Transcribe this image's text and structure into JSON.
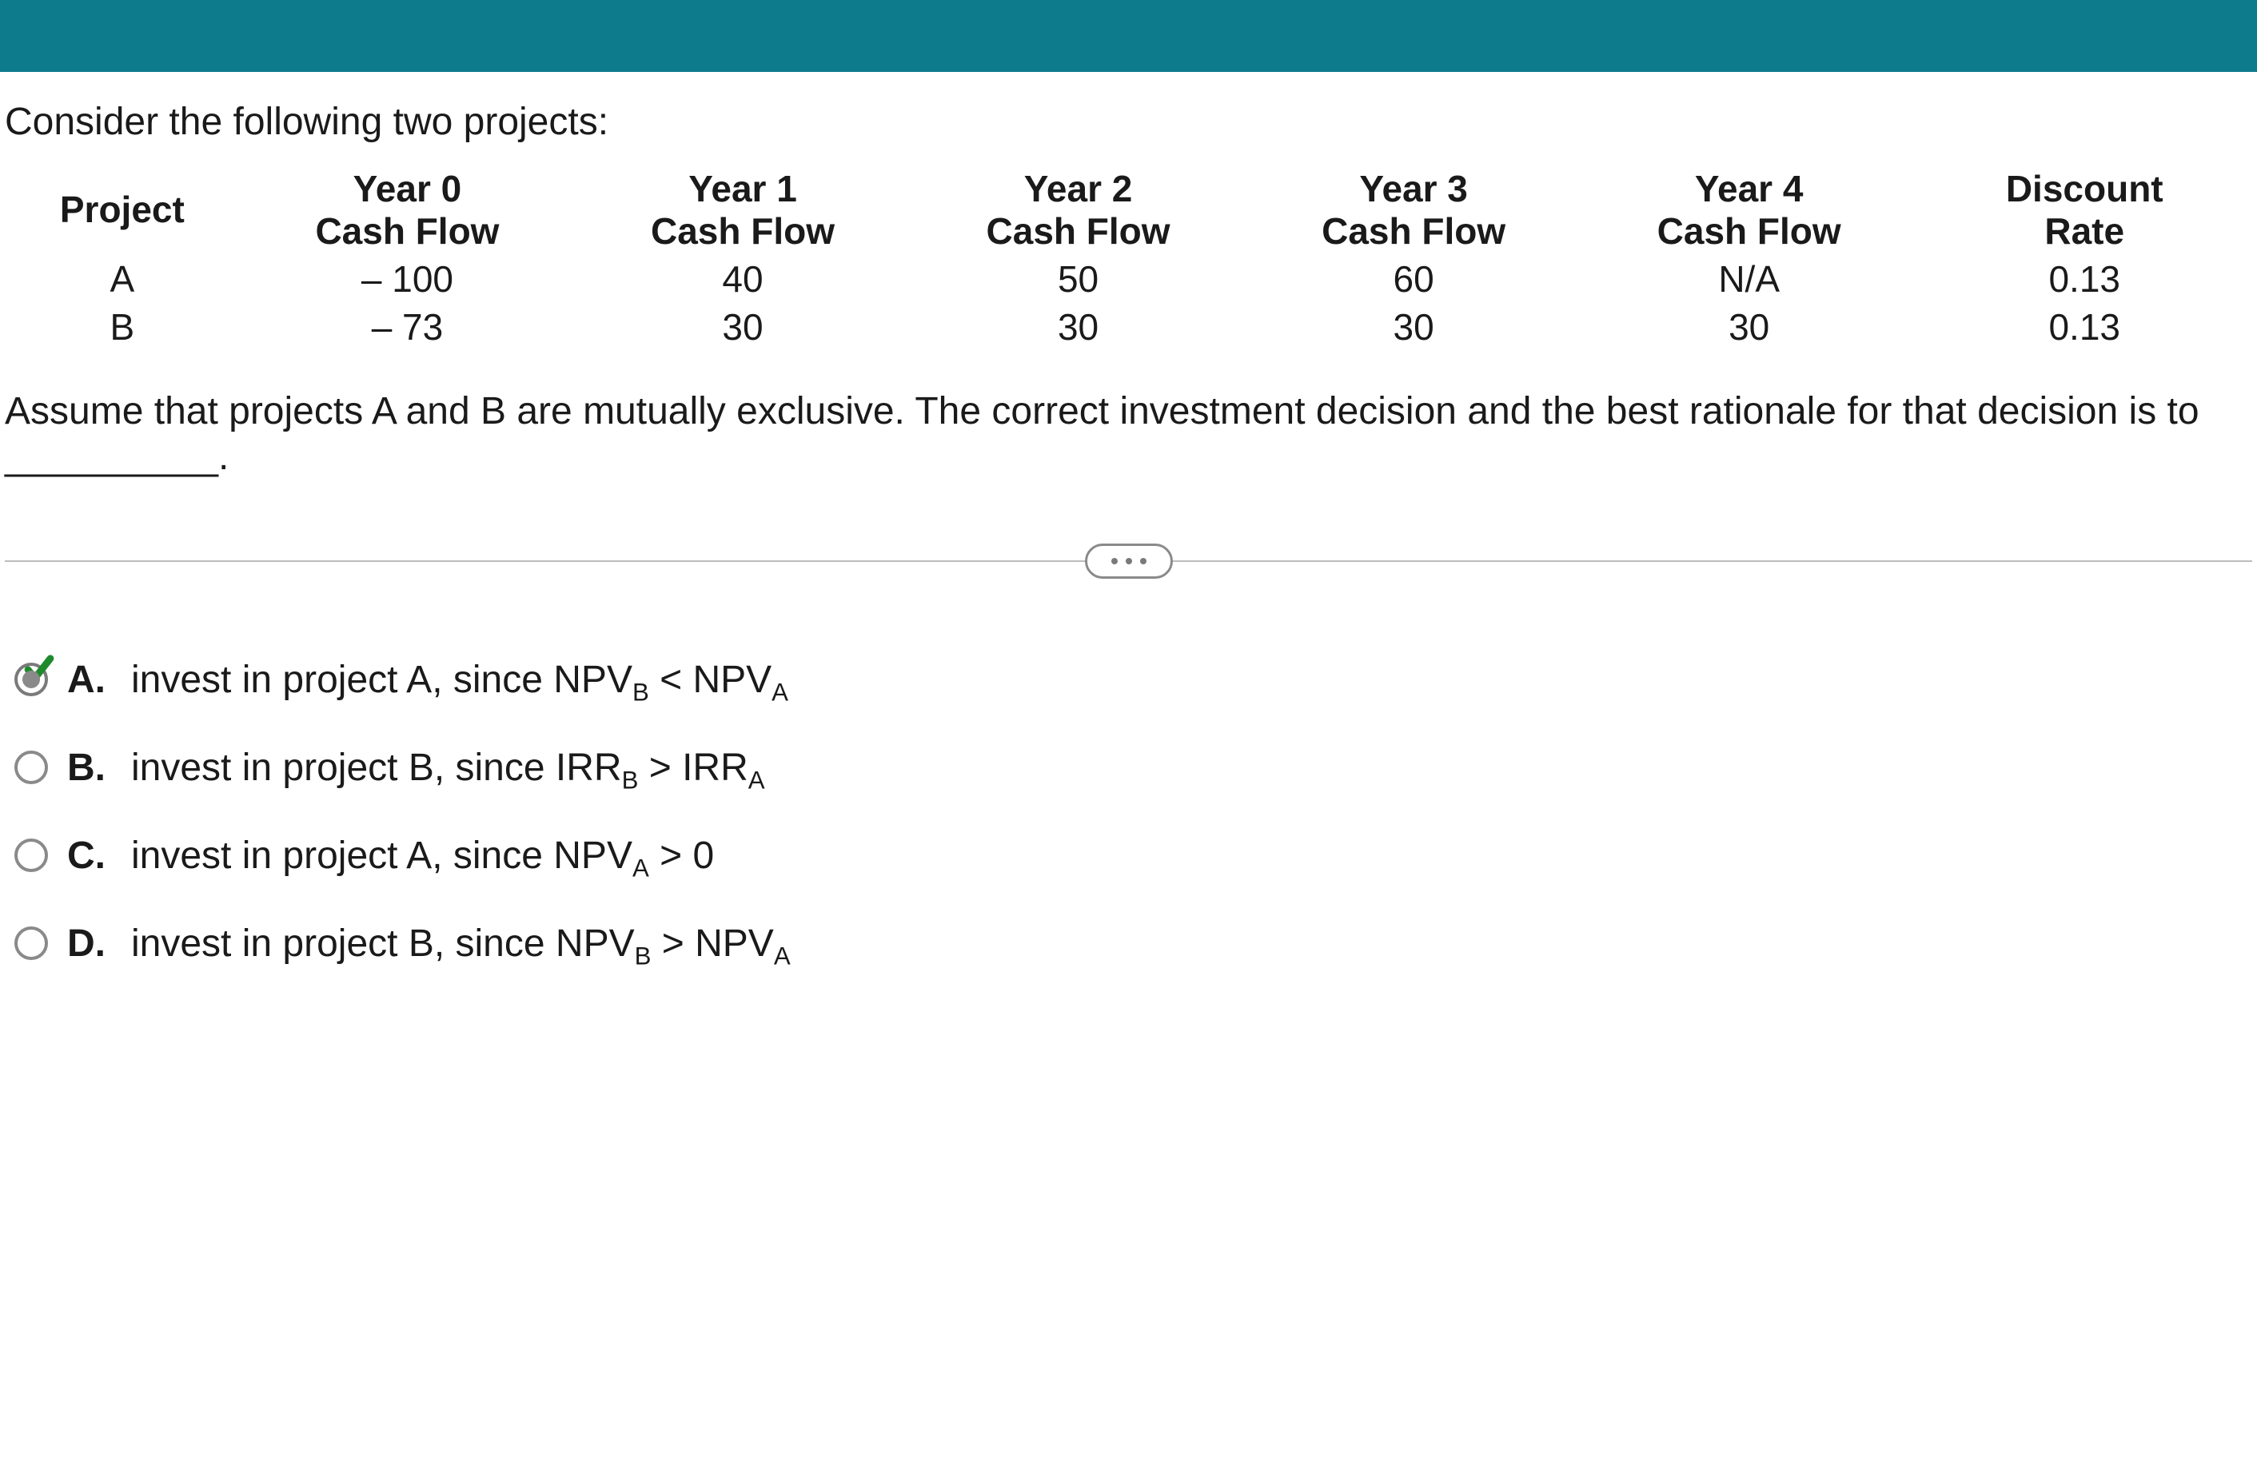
{
  "intro": "Consider the following two projects:",
  "table": {
    "headers": {
      "project": "Project",
      "y0a": "Year 0",
      "y0b": "Cash Flow",
      "y1a": "Year 1",
      "y1b": "Cash Flow",
      "y2a": "Year 2",
      "y2b": "Cash Flow",
      "y3a": "Year 3",
      "y3b": "Cash Flow",
      "y4a": "Year 4",
      "y4b": "Cash Flow",
      "dra": "Discount",
      "drb": "Rate"
    },
    "rowA": {
      "proj": "A",
      "y0": "– 100",
      "y1": "40",
      "y2": "50",
      "y3": "60",
      "y4": "N/A",
      "dr": "0.13"
    },
    "rowB": {
      "proj": "B",
      "y0": "– 73",
      "y1": "30",
      "y2": "30",
      "y3": "30",
      "y4": "30",
      "dr": "0.13"
    }
  },
  "conclude": "Assume that projects A and B are mutually exclusive. The correct investment decision and the best rationale for that decision is to __________.",
  "options": {
    "A": {
      "letter": "A.",
      "pre": "invest in project A, since NPV",
      "sub1": "B",
      "mid": " < NPV",
      "sub2": "A",
      "selected": true,
      "correct": true
    },
    "B": {
      "letter": "B.",
      "pre": "invest in project B, since IRR",
      "sub1": "B",
      "mid": " > IRR",
      "sub2": "A",
      "selected": false
    },
    "C": {
      "letter": "C.",
      "pre": "invest in project A, since NPV",
      "sub1": "A",
      "mid": " > 0",
      "sub2": "",
      "selected": false
    },
    "D": {
      "letter": "D.",
      "pre": "invest in project B, since NPV",
      "sub1": "B",
      "mid": " > NPV",
      "sub2": "A",
      "selected": false
    }
  }
}
